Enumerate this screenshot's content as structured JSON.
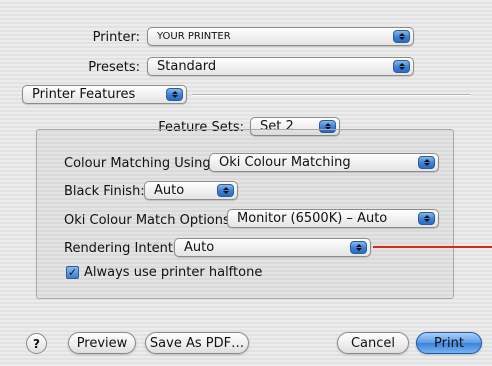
{
  "printer": {
    "label": "Printer:",
    "value": "YOUR PRINTER"
  },
  "presets": {
    "label": "Presets:",
    "value": "Standard"
  },
  "panel": {
    "value": "Printer Features"
  },
  "feature_sets": {
    "label": "Feature Sets:",
    "value": "Set 2"
  },
  "options": {
    "colour_matching": {
      "label": "Colour Matching Using:",
      "value": "Oki Colour Matching"
    },
    "black_finish": {
      "label": "Black Finish:",
      "value": "Auto"
    },
    "oki_colour_match": {
      "label": "Oki Colour Match Options:",
      "value": "Monitor (6500K) – Auto"
    },
    "rendering_intent": {
      "label": "Rendering Intent:",
      "value": "Auto"
    },
    "halftone": {
      "label": "Always use printer halftone",
      "checked": true,
      "check_glyph": "✓"
    }
  },
  "footer": {
    "help_label": "?",
    "preview_label": "Preview",
    "save_pdf_label": "Save As PDF…",
    "cancel_label": "Cancel",
    "print_label": "Print"
  },
  "colors": {
    "accent": "#3b7fd3",
    "annotation_line": "#d9281e"
  }
}
